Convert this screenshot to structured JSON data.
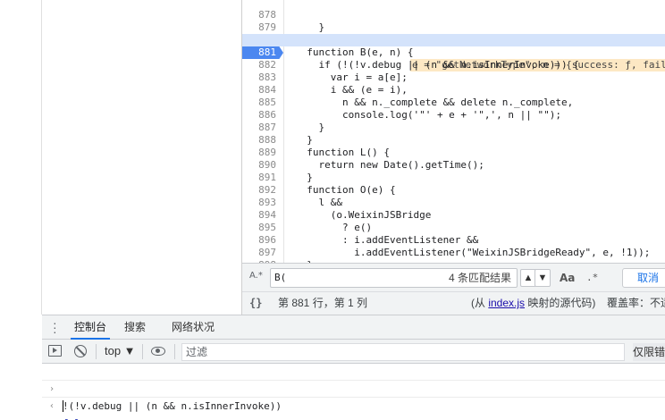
{
  "editor": {
    "lines": [
      {
        "num": "878",
        "code": "    }"
      },
      {
        "num": "879",
        "code": "  }"
      },
      {
        "num": "880",
        "code": "  function B(e, n) {"
      },
      {
        "num": "881",
        "code": "    if (!(!v.debug || (n && n.isInnerInvoke))) {"
      },
      {
        "num": "882",
        "code": "      var i = a[e];"
      },
      {
        "num": "883",
        "code": "      i && (e = i),"
      },
      {
        "num": "884",
        "code": "        n && n._complete && delete n._complete,"
      },
      {
        "num": "885",
        "code": "        console.log('\"' + e + '\",', n || \"\");"
      },
      {
        "num": "886",
        "code": "    }"
      },
      {
        "num": "887",
        "code": "  }"
      },
      {
        "num": "888",
        "code": "  function L() {"
      },
      {
        "num": "889",
        "code": "    return new Date().getTime();"
      },
      {
        "num": "890",
        "code": "  }"
      },
      {
        "num": "891",
        "code": "  function O(e) {"
      },
      {
        "num": "892",
        "code": "    l &&"
      },
      {
        "num": "893",
        "code": "      (o.WeixinJSBridge"
      },
      {
        "num": "894",
        "code": "        ? e()"
      },
      {
        "num": "895",
        "code": "        : i.addEventListener &&"
      },
      {
        "num": "896",
        "code": "          i.addEventListener(\"WeixinJSBridgeReady\", e, !1));"
      },
      {
        "num": "897",
        "code": "  }"
      },
      {
        "num": "898",
        "code": ""
      }
    ],
    "inline_value": "e = \"getNetworkType\", n = {success: ƒ, fail:",
    "paused_line": "881"
  },
  "search": {
    "toggle_label": "A.*",
    "query": "B(",
    "match_count": "4 条匹配结果",
    "prev_icon": "chevron-up-icon",
    "next_icon": "chevron-down-icon",
    "match_case_label": "Aa",
    "regex_label": ".*",
    "cancel_label": "取消"
  },
  "status": {
    "format_label": "{}",
    "position": "第 881 行，第 1 列",
    "source_prefix": "(从 ",
    "source_link": "index.js",
    "source_suffix": " 映射的源代码)",
    "coverage": "覆盖率：不适"
  },
  "drawer": {
    "tabs": [
      "控制台",
      "搜索",
      "网络状况"
    ],
    "active_tab": "控制台"
  },
  "console_toolbar": {
    "context": "top ▼",
    "filter_placeholder": "过滤",
    "levels_label": "仅限错"
  },
  "console": {
    "input_expr": "!(!v.debug || (n && n.isInnerInvoke))",
    "result": "false"
  }
}
